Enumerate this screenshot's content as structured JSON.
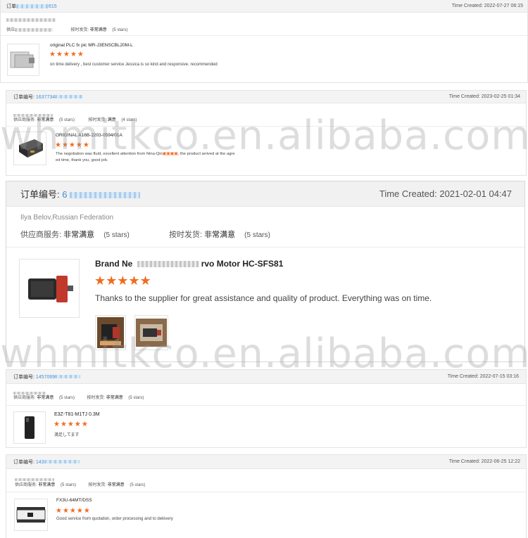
{
  "reviews": [
    {
      "order_label": "订单",
      "order_number": "615",
      "time_created": "Time Created: 2022-07-27 06:15",
      "reviewer": "",
      "supplier_service_label": "供应",
      "supplier_service_value": "",
      "supplier_service_stars": "",
      "ontime_label": "按时发货:",
      "ontime_value": "非常满意",
      "ontime_stars": "(5 stars)",
      "product_title": "original PLC fx pic MR-J3ENSCBL20M-L",
      "stars": "★★★★★",
      "comment": "on time delivery , best customer service Jessica is so kind and responsive. recommended"
    },
    {
      "order_label": "订单编号:",
      "order_number": "1637734",
      "time_created": "Time Created: 2023-02-25 01:34",
      "reviewer": "",
      "supplier_service_label": "供应商服务:",
      "supplier_service_value": "非常满意",
      "supplier_service_stars": "(5 stars)",
      "ontime_label": "按时发货:",
      "ontime_value": "满意",
      "ontime_stars": "(4 stars)",
      "product_title": "ORIGINAL A16B-2203-0594/01A",
      "stars": "★★★★★",
      "comment_a": "The negotiation was fluid, excellent attention from Nina-Qin",
      "comment_b": ", the product arrived at the agre",
      "comment_c": "ed time, thank you, good job."
    },
    {
      "order_label": "订单编号:",
      "order_number": "6",
      "time_created": "Time Created: 2021-02-01 04:47",
      "reviewer": "Ilya Belov,Russian Federation",
      "supplier_service_label": "供应商服务:",
      "supplier_service_value": "非常满意",
      "supplier_service_stars": "(5 stars)",
      "ontime_label": "按时发货:",
      "ontime_value": "非常满意",
      "ontime_stars": "(5 stars)",
      "product_title_a": "Brand Ne",
      "product_title_b": "rvo Motor HC-SFS81",
      "stars": "★★★★★",
      "comment": "Thanks to the supplier for great assistance and quality of product. Everything was on time."
    },
    {
      "order_label": "订单编号:",
      "order_number": "1457069",
      "time_created": "Time Created: 2022-07-15 03:16",
      "reviewer": "",
      "supplier_service_label": "供应商服务:",
      "supplier_service_value": "非常满意",
      "supplier_service_stars": "(5 stars)",
      "ontime_label": "按时发货:",
      "ontime_value": "非常满意",
      "ontime_stars": "(5 stars)",
      "product_title": "E3Z-T81-M1TJ 0.3M",
      "stars": "★★★★★",
      "comment": "満足してます"
    },
    {
      "order_label": "订单编号:",
      "order_number": "143",
      "time_created": "Time Created: 2022-06-25 12:22",
      "reviewer": "",
      "supplier_service_label": "供应商服务:",
      "supplier_service_value": "非常满意",
      "supplier_service_stars": "(5 stars)",
      "ontime_label": "按时发货:",
      "ontime_value": "非常满意",
      "ontime_stars": "(5 stars)",
      "product_title": "FX3U-64MT/DSS",
      "stars": "★★★★★",
      "comment": "Good service from quotation, order processing and to dekivery"
    }
  ],
  "watermark": "whmitkco.en.alibaba.com",
  "colors": {
    "star": "#f26b1d",
    "order_link": "#3d8fd8",
    "header_bg": "#f3f3f3"
  }
}
